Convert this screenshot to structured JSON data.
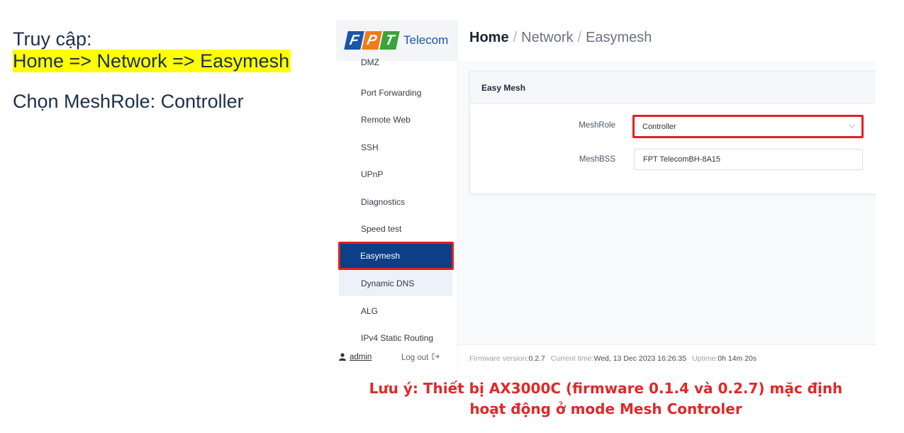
{
  "instructions": {
    "access_label": "Truy cập:",
    "path": "Home => Network => Easymesh",
    "choose": "Chọn MeshRole: Controller"
  },
  "brand": {
    "logo_letters": [
      "F",
      "P",
      "T"
    ],
    "logo_text": "Telecom",
    "colors": {
      "blue": "#1a56a8",
      "orange": "#f07b1a",
      "green": "#3aa53a"
    }
  },
  "breadcrumb": {
    "home": "Home",
    "section": "Network",
    "page": "Easymesh",
    "separator": "/"
  },
  "sidebar": {
    "items": [
      {
        "label": "DMZ"
      },
      {
        "label": "Port Forwarding"
      },
      {
        "label": "Remote Web"
      },
      {
        "label": "SSH"
      },
      {
        "label": "UPnP"
      },
      {
        "label": "Diagnostics"
      },
      {
        "label": "Speed test"
      },
      {
        "label": "Easymesh",
        "active": true
      },
      {
        "label": "Dynamic DNS"
      },
      {
        "label": "ALG"
      },
      {
        "label": "IPv4 Static Routing"
      }
    ],
    "user": "admin",
    "user_icon": "user-icon",
    "logout": "Log out",
    "logout_icon": "logout-icon"
  },
  "card": {
    "title": "Easy Mesh",
    "mesh_role_label": "MeshRole",
    "mesh_role_value": "Controller",
    "mesh_bss_label": "MeshBSS",
    "mesh_bss_value": "FPT TelecomBH-8A15"
  },
  "status": {
    "firmware_label": "Firmware version:",
    "firmware_value": "0.2.7",
    "time_label": "Current time:",
    "time_value": "Wed, 13 Dec 2023 16:26:35",
    "uptime_label": "Uptime:",
    "uptime_value": "0h 14m 20s"
  },
  "note": {
    "line1": "Lưu ý: Thiết bị AX3000C  (firmware 0.1.4 và 0.2.7) mặc định",
    "line2": "hoạt động ở mode Mesh Controler"
  },
  "highlight_colors": {
    "marker": "#ffff00",
    "callout_border": "#e02020",
    "note_text": "#e02828",
    "active_nav": "#0c3f86"
  }
}
